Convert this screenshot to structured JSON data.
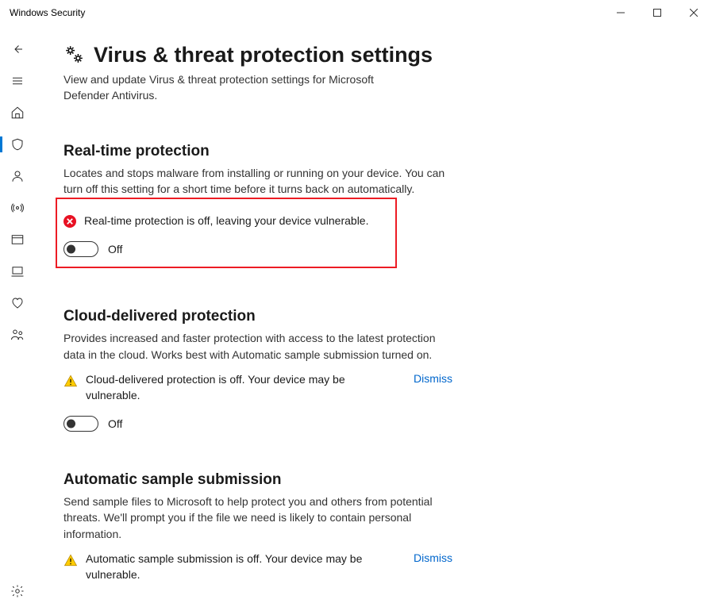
{
  "window": {
    "title": "Windows Security"
  },
  "page": {
    "heading": "Virus & threat protection settings",
    "subtitle": "View and update Virus & threat protection settings for Microsoft Defender Antivirus."
  },
  "sections": {
    "realtime": {
      "title": "Real-time protection",
      "desc": "Locates and stops malware from installing or running on your device. You can turn off this setting for a short time before it turns back on automatically.",
      "warning": "Real-time protection is off, leaving your device vulnerable.",
      "toggle_label": "Off"
    },
    "cloud": {
      "title": "Cloud-delivered protection",
      "desc": "Provides increased and faster protection with access to the latest protection data in the cloud. Works best with Automatic sample submission turned on.",
      "warning": "Cloud-delivered protection is off. Your device may be vulnerable.",
      "dismiss": "Dismiss",
      "toggle_label": "Off"
    },
    "sample": {
      "title": "Automatic sample submission",
      "desc": "Send sample files to Microsoft to help protect you and others from potential threats. We'll prompt you if the file we need is likely to contain personal information.",
      "warning": "Automatic sample submission is off. Your device may be vulnerable.",
      "dismiss": "Dismiss"
    }
  }
}
